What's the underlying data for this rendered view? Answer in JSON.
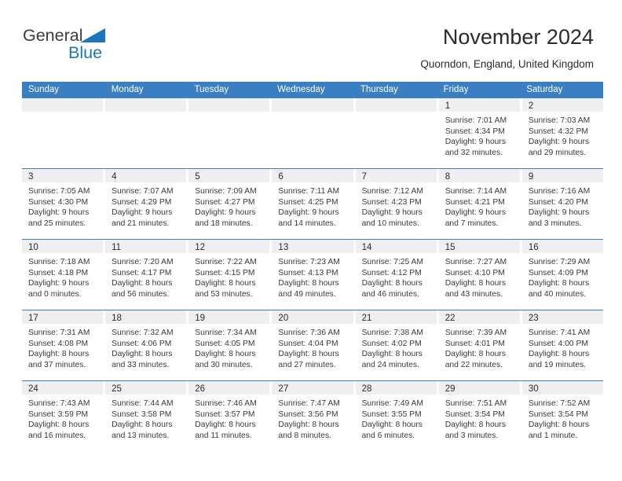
{
  "brand": {
    "name_top": "General",
    "name_bottom": "Blue",
    "triangle_color": "#1b75bb",
    "text_color": "#3b3b3b"
  },
  "header": {
    "title": "November 2024",
    "subtitle": "Quorndon, England, United Kingdom"
  },
  "theme": {
    "header_bar": "#3a7fc1",
    "day_bar": "#efefef",
    "row_rule": "#3a7fc1",
    "text": "#2b2b2b"
  },
  "weekdays": [
    "Sunday",
    "Monday",
    "Tuesday",
    "Wednesday",
    "Thursday",
    "Friday",
    "Saturday"
  ],
  "weeks": [
    [
      {
        "day": "",
        "lines": []
      },
      {
        "day": "",
        "lines": []
      },
      {
        "day": "",
        "lines": []
      },
      {
        "day": "",
        "lines": []
      },
      {
        "day": "",
        "lines": []
      },
      {
        "day": "1",
        "lines": [
          "Sunrise: 7:01 AM",
          "Sunset: 4:34 PM",
          "Daylight: 9 hours",
          "and 32 minutes."
        ]
      },
      {
        "day": "2",
        "lines": [
          "Sunrise: 7:03 AM",
          "Sunset: 4:32 PM",
          "Daylight: 9 hours",
          "and 29 minutes."
        ]
      }
    ],
    [
      {
        "day": "3",
        "lines": [
          "Sunrise: 7:05 AM",
          "Sunset: 4:30 PM",
          "Daylight: 9 hours",
          "and 25 minutes."
        ]
      },
      {
        "day": "4",
        "lines": [
          "Sunrise: 7:07 AM",
          "Sunset: 4:29 PM",
          "Daylight: 9 hours",
          "and 21 minutes."
        ]
      },
      {
        "day": "5",
        "lines": [
          "Sunrise: 7:09 AM",
          "Sunset: 4:27 PM",
          "Daylight: 9 hours",
          "and 18 minutes."
        ]
      },
      {
        "day": "6",
        "lines": [
          "Sunrise: 7:11 AM",
          "Sunset: 4:25 PM",
          "Daylight: 9 hours",
          "and 14 minutes."
        ]
      },
      {
        "day": "7",
        "lines": [
          "Sunrise: 7:12 AM",
          "Sunset: 4:23 PM",
          "Daylight: 9 hours",
          "and 10 minutes."
        ]
      },
      {
        "day": "8",
        "lines": [
          "Sunrise: 7:14 AM",
          "Sunset: 4:21 PM",
          "Daylight: 9 hours",
          "and 7 minutes."
        ]
      },
      {
        "day": "9",
        "lines": [
          "Sunrise: 7:16 AM",
          "Sunset: 4:20 PM",
          "Daylight: 9 hours",
          "and 3 minutes."
        ]
      }
    ],
    [
      {
        "day": "10",
        "lines": [
          "Sunrise: 7:18 AM",
          "Sunset: 4:18 PM",
          "Daylight: 9 hours",
          "and 0 minutes."
        ]
      },
      {
        "day": "11",
        "lines": [
          "Sunrise: 7:20 AM",
          "Sunset: 4:17 PM",
          "Daylight: 8 hours",
          "and 56 minutes."
        ]
      },
      {
        "day": "12",
        "lines": [
          "Sunrise: 7:22 AM",
          "Sunset: 4:15 PM",
          "Daylight: 8 hours",
          "and 53 minutes."
        ]
      },
      {
        "day": "13",
        "lines": [
          "Sunrise: 7:23 AM",
          "Sunset: 4:13 PM",
          "Daylight: 8 hours",
          "and 49 minutes."
        ]
      },
      {
        "day": "14",
        "lines": [
          "Sunrise: 7:25 AM",
          "Sunset: 4:12 PM",
          "Daylight: 8 hours",
          "and 46 minutes."
        ]
      },
      {
        "day": "15",
        "lines": [
          "Sunrise: 7:27 AM",
          "Sunset: 4:10 PM",
          "Daylight: 8 hours",
          "and 43 minutes."
        ]
      },
      {
        "day": "16",
        "lines": [
          "Sunrise: 7:29 AM",
          "Sunset: 4:09 PM",
          "Daylight: 8 hours",
          "and 40 minutes."
        ]
      }
    ],
    [
      {
        "day": "17",
        "lines": [
          "Sunrise: 7:31 AM",
          "Sunset: 4:08 PM",
          "Daylight: 8 hours",
          "and 37 minutes."
        ]
      },
      {
        "day": "18",
        "lines": [
          "Sunrise: 7:32 AM",
          "Sunset: 4:06 PM",
          "Daylight: 8 hours",
          "and 33 minutes."
        ]
      },
      {
        "day": "19",
        "lines": [
          "Sunrise: 7:34 AM",
          "Sunset: 4:05 PM",
          "Daylight: 8 hours",
          "and 30 minutes."
        ]
      },
      {
        "day": "20",
        "lines": [
          "Sunrise: 7:36 AM",
          "Sunset: 4:04 PM",
          "Daylight: 8 hours",
          "and 27 minutes."
        ]
      },
      {
        "day": "21",
        "lines": [
          "Sunrise: 7:38 AM",
          "Sunset: 4:02 PM",
          "Daylight: 8 hours",
          "and 24 minutes."
        ]
      },
      {
        "day": "22",
        "lines": [
          "Sunrise: 7:39 AM",
          "Sunset: 4:01 PM",
          "Daylight: 8 hours",
          "and 22 minutes."
        ]
      },
      {
        "day": "23",
        "lines": [
          "Sunrise: 7:41 AM",
          "Sunset: 4:00 PM",
          "Daylight: 8 hours",
          "and 19 minutes."
        ]
      }
    ],
    [
      {
        "day": "24",
        "lines": [
          "Sunrise: 7:43 AM",
          "Sunset: 3:59 PM",
          "Daylight: 8 hours",
          "and 16 minutes."
        ]
      },
      {
        "day": "25",
        "lines": [
          "Sunrise: 7:44 AM",
          "Sunset: 3:58 PM",
          "Daylight: 8 hours",
          "and 13 minutes."
        ]
      },
      {
        "day": "26",
        "lines": [
          "Sunrise: 7:46 AM",
          "Sunset: 3:57 PM",
          "Daylight: 8 hours",
          "and 11 minutes."
        ]
      },
      {
        "day": "27",
        "lines": [
          "Sunrise: 7:47 AM",
          "Sunset: 3:56 PM",
          "Daylight: 8 hours",
          "and 8 minutes."
        ]
      },
      {
        "day": "28",
        "lines": [
          "Sunrise: 7:49 AM",
          "Sunset: 3:55 PM",
          "Daylight: 8 hours",
          "and 6 minutes."
        ]
      },
      {
        "day": "29",
        "lines": [
          "Sunrise: 7:51 AM",
          "Sunset: 3:54 PM",
          "Daylight: 8 hours",
          "and 3 minutes."
        ]
      },
      {
        "day": "30",
        "lines": [
          "Sunrise: 7:52 AM",
          "Sunset: 3:54 PM",
          "Daylight: 8 hours",
          "and 1 minute."
        ]
      }
    ]
  ]
}
